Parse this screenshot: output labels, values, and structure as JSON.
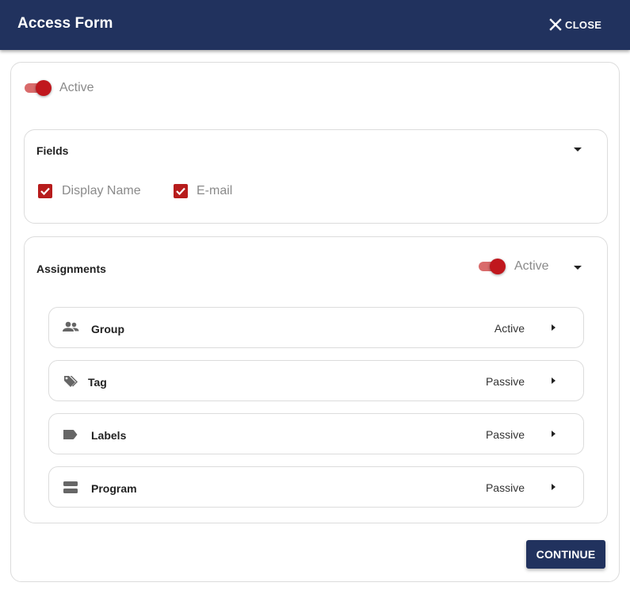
{
  "header": {
    "title": "Access Form",
    "close_label": "CLOSE"
  },
  "form": {
    "active_toggle": {
      "label": "Active",
      "on": true
    },
    "fields": {
      "title": "Fields",
      "options": [
        {
          "label": "Display Name",
          "checked": true
        },
        {
          "label": "E-mail",
          "checked": true
        }
      ]
    },
    "assignments": {
      "title": "Assignments",
      "toggle": {
        "label": "Active",
        "on": true
      },
      "items": [
        {
          "label": "Group",
          "status": "Active",
          "icon": "group-icon"
        },
        {
          "label": "Tag",
          "status": "Passive",
          "icon": "tags-icon"
        },
        {
          "label": "Labels",
          "status": "Passive",
          "icon": "label-icon"
        },
        {
          "label": "Program",
          "status": "Passive",
          "icon": "storage-icon"
        }
      ]
    },
    "continue_label": "CONTINUE"
  },
  "colors": {
    "header_bg": "#21325e",
    "accent_red": "#c0171d",
    "button_bg": "#21325e"
  }
}
